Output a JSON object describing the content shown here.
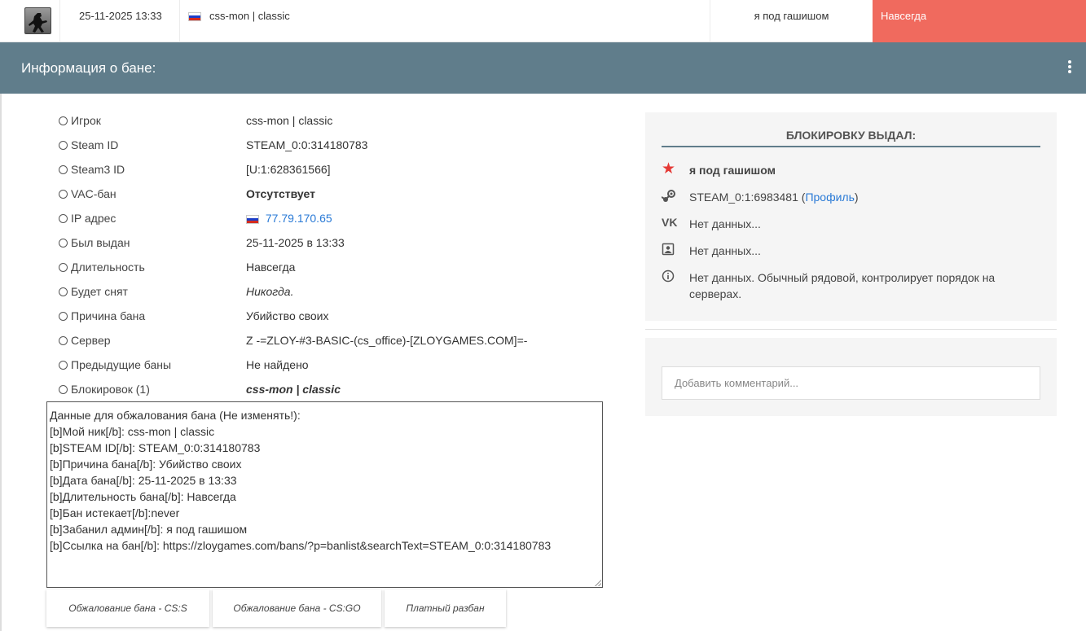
{
  "top_row": {
    "date": "25-11-2025 13:33",
    "nickname": "css-mon | classic",
    "admin": "я под гашишом",
    "length": "Навсегда"
  },
  "header": {
    "title": "Информация о бане:"
  },
  "details": [
    {
      "label": "Игрок",
      "value": "css-mon | classic"
    },
    {
      "label": "Steam ID",
      "value": "STEAM_0:0:314180783"
    },
    {
      "label": "Steam3 ID",
      "value": "[U:1:628361566]"
    },
    {
      "label": "VAC-бан",
      "value": "Отсутствует"
    },
    {
      "label": "IP адрес",
      "value": "77.79.170.65"
    },
    {
      "label": "Был выдан",
      "value": "25-11-2025 в 13:33"
    },
    {
      "label": "Длительность",
      "value": "Навсегда"
    },
    {
      "label": "Будет снят",
      "value": "Никогда."
    },
    {
      "label": "Причина бана",
      "value": "Убийство своих"
    },
    {
      "label": "Сервер",
      "value": "Z -=ZLOY-#3-BASIC-(cs_office)-[ZLOYGAMES.COM]=-"
    },
    {
      "label": "Предыдущие баны",
      "value": "Не найдено"
    },
    {
      "label": "Блокировок (1)",
      "value": "css-mon | classic"
    }
  ],
  "appeal_text": {
    "lines": [
      "Данные для обжалования бана (Не изменять!):",
      "[b]Мой ник[/b]: css-mon | classic",
      "[b]STEAM ID[/b]: STEAM_0:0:314180783",
      "[b]Причина бана[/b]: Убийство своих",
      "[b]Дата бана[/b]: 25-11-2025 в 13:33",
      "[b]Длительность бана[/b]: Навсегда",
      "[b]Бан истекает[/b]:never",
      "[b]Забанил админ[/b]: я под гашишом",
      "[b]Ссылка на бан[/b]: https://zloygames.com/bans/?p=banlist&searchText=STEAM_0:0:314180783"
    ]
  },
  "buttons": {
    "appeal_css": "Обжалование бана - CS:S",
    "appeal_csgo": "Обжалование бана - CS:GO",
    "paid_unban": "Платный разбан"
  },
  "admin_card": {
    "title": "БЛОКИРОВКУ ВЫДАЛ:",
    "name": "я под гашишом",
    "steam_id": "STEAM_0:1:6983481",
    "profile_link": "Профиль",
    "vk": "Нет данных...",
    "contact": "Нет данных...",
    "info": "Нет данных. Обычный рядовой, контролирует порядок на серверах."
  },
  "comment": {
    "placeholder": "Добавить комментарий..."
  },
  "colors": {
    "header": "#607d8b",
    "length_badge": "#f06a5e",
    "link": "#2a7ad6",
    "star": "#e53935"
  }
}
